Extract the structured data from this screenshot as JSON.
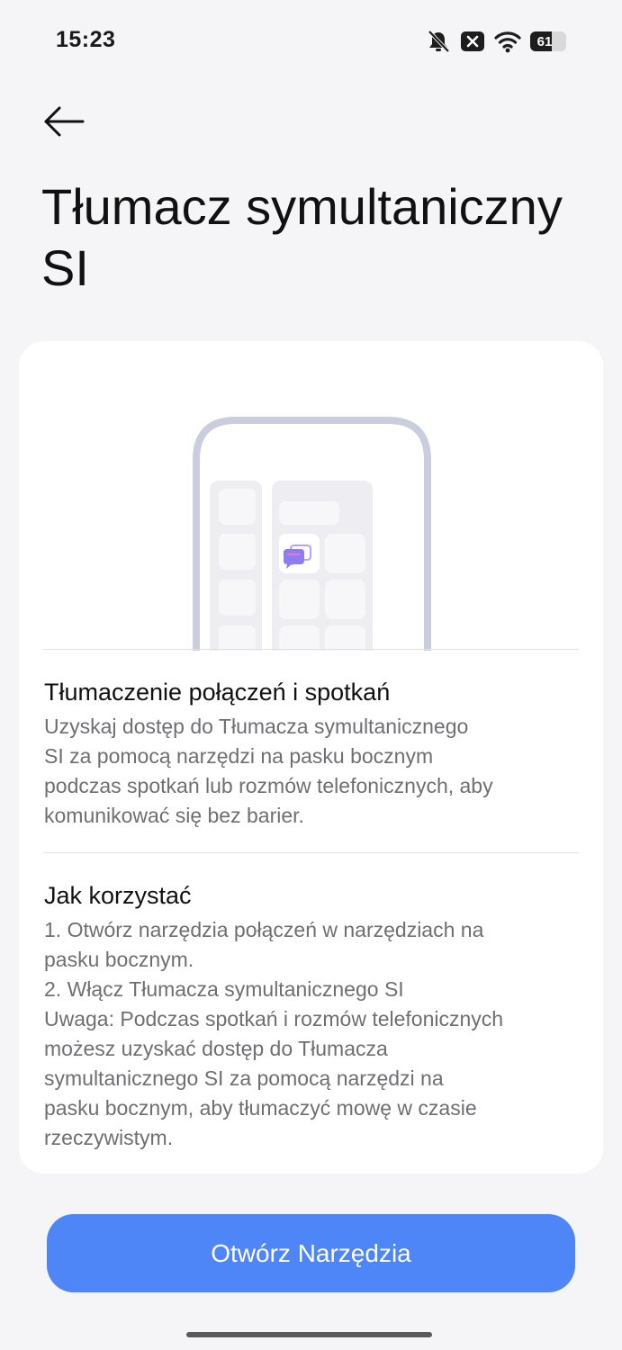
{
  "status_bar": {
    "time": "15:23",
    "battery_level": "61",
    "icons": [
      "mute-icon",
      "notification-x-icon",
      "wifi-icon",
      "battery-icon"
    ]
  },
  "header": {
    "back_icon": "back-arrow-icon",
    "title": "Tłumacz symultaniczny SI"
  },
  "card": {
    "illustration": {
      "app_icon": "chat-translate-icon",
      "colors": {
        "frame": "#c9cdde",
        "tile": "#f5f5f7",
        "panel": "#ededf2",
        "accent_pink": "#e879c6",
        "accent_blue": "#6a8cf7"
      }
    },
    "sections": [
      {
        "title": "Tłumaczenie połączeń i spotkań",
        "body": "Uzyskaj dostęp do Tłumacza symultanicznego\nSI za pomocą narzędzi na pasku bocznym\npodczas spotkań lub rozmów telefonicznych, aby\nkomunikować się bez barier."
      },
      {
        "title": "Jak korzystać",
        "body": "1. Otwórz narzędzia połączeń w narzędziach na\npasku bocznym.\n2. Włącz Tłumacza symultanicznego SI\nUwaga: Podczas spotkań i rozmów telefonicznych\nmożesz uzyskać dostęp do Tłumacza\nsymultanicznego SI za pomocą narzędzi na\npasku bocznym, aby tłumaczyć mowę w czasie\nrzeczywistym."
      }
    ]
  },
  "primary_button": {
    "label": "Otwórz Narzędzia",
    "color": "#4e86f7"
  }
}
